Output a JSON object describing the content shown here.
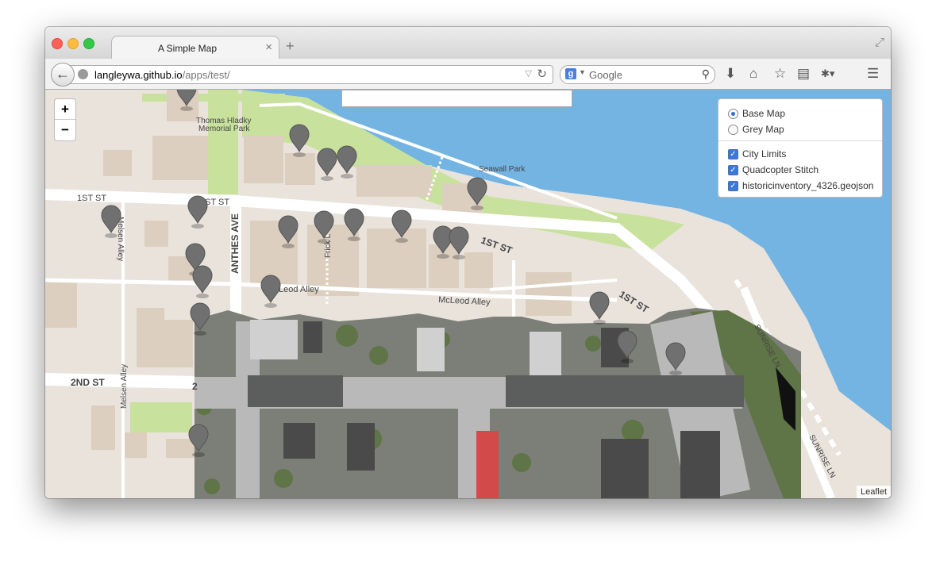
{
  "tab": {
    "title": "A Simple Map",
    "close": "×",
    "new": "+"
  },
  "urlbar": {
    "host": "langleywa.github.io",
    "path": "/apps/test/"
  },
  "search": {
    "placeholder": "Google",
    "engine": "g"
  },
  "map": {
    "zoom_in": "+",
    "zoom_out": "−",
    "labels": {
      "park_hladky": "Thomas Hladky",
      "park_hladky_2": "Memorial Park",
      "seawall": "Seawall Park",
      "first_st_a": "1ST ST",
      "first_st_b": "1ST ST",
      "first_st_c": "1ST ST",
      "first_st_d": "1ST ST",
      "anthes": "ANTHES AVE",
      "melsen_a": "Melsen Alley",
      "melsen_b": "Melsen Alley",
      "frick": "Frick L",
      "mcleod_a": "Leod Alley",
      "mcleod_b": "McLeod Alley",
      "second_st": "2ND ST",
      "second_st_b": "2",
      "sunrise_a": "SUNRISE LN",
      "sunrise_b": "SUNRISE LN"
    },
    "attribution": "Leaflet"
  },
  "layers": {
    "base": [
      {
        "label": "Base Map",
        "selected": true
      },
      {
        "label": "Grey Map",
        "selected": false
      }
    ],
    "overlays": [
      {
        "label": "City Limits",
        "checked": true
      },
      {
        "label": "Quadcopter Stitch",
        "checked": true
      },
      {
        "label": "historicinventory_4326.geojson",
        "checked": true
      }
    ]
  },
  "colors": {
    "water": "#74b4e3",
    "park": "#c8e19c",
    "land": "#e9e3dc",
    "building": "#dccfc0",
    "marker": "#6e6e6e"
  }
}
